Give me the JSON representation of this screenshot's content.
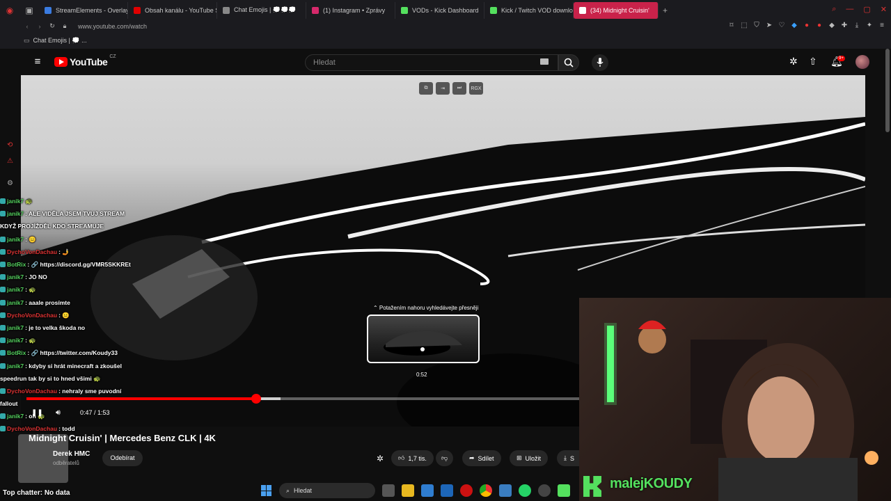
{
  "browser": {
    "tabs": [
      {
        "label": "StreamElements - Overlay",
        "color": "#3a7be0"
      },
      {
        "label": "Obsah kanálu - YouTube S",
        "color": "#e00000"
      },
      {
        "label": "Chat Emojis | 💭💭💭",
        "color": "#888888"
      },
      {
        "label": "(1) Instagram • Zprávy",
        "color": "#d6296b"
      },
      {
        "label": "VODs - Kick Dashboard",
        "color": "#54e05e"
      },
      {
        "label": "Kick / Twitch VOD downlo",
        "color": "#54e05e"
      },
      {
        "label": "(34) Midnight Cruisin'",
        "color": "#ffffff",
        "active": true
      }
    ],
    "url": "www.youtube.com/watch",
    "bookmark": "Chat Emojis | 💭 ..."
  },
  "youtube": {
    "logo_text": "YouTube",
    "region": "CZ",
    "search_placeholder": "Hledat",
    "notification_count": "9+"
  },
  "player": {
    "top_icons": [
      "miniplayer",
      "theater",
      "next",
      "RGX"
    ],
    "seek_hint": "⌃ Potažením nahoru vyhledávejte přesněji",
    "preview_time": "0:52",
    "current_time": "0:47",
    "duration": "1:53",
    "time_display": "0:47 / 1:53",
    "progress_fraction": 0.416,
    "hover_fraction": 0.46
  },
  "chat": [
    {
      "user": "janik7",
      "msg": "🐢",
      "color": "green"
    },
    {
      "user": "janik7",
      "msg": ": ALE VIDĚLA JSEM TVUJ STREAM",
      "color": "green"
    },
    {
      "user": "",
      "msg": "KDYŽ PROJÍŽDĚL KDO STREAMUJE",
      "color": "green"
    },
    {
      "user": "janik7",
      "msg": ": 😐",
      "color": "green"
    },
    {
      "user": "DychoVonDachau",
      "msg": ": 🤳",
      "color": "red"
    },
    {
      "user": "BotRix",
      "msg": ": 🔗 https://discord.gg/VMR5SKKREt",
      "color": "green"
    },
    {
      "user": "janik7",
      "msg": ": JO NO",
      "color": "green"
    },
    {
      "user": "janik7",
      "msg": ": 🐢",
      "color": "green"
    },
    {
      "user": "janik7",
      "msg": ": aaale prosímte",
      "color": "green"
    },
    {
      "user": "DychoVonDachau",
      "msg": ": 😐",
      "color": "red"
    },
    {
      "user": "janik7",
      "msg": ": je to velka škoda no",
      "color": "green"
    },
    {
      "user": "janik7",
      "msg": ": 🐢",
      "color": "green"
    },
    {
      "user": "BotRix",
      "msg": ": 🔗 https://twitter.com/Koudy33",
      "color": "green"
    },
    {
      "user": "janik7",
      "msg": ": kdyby si hrát minecraft a zkoušel",
      "color": "green"
    },
    {
      "user": "",
      "msg": "speedrun tak by si to hned všimi 🐢",
      "color": "green"
    },
    {
      "user": "DychoVonDachau",
      "msg": ": nehraly sme puvodní",
      "color": "red"
    },
    {
      "user": "",
      "msg": "fallout",
      "color": "green"
    },
    {
      "user": "janik7",
      "msg": ": oh 🐢",
      "color": "green"
    },
    {
      "user": "DychoVonDachau",
      "msg": ": todd",
      "color": "red"
    }
  ],
  "video": {
    "title": "Midnight Cruisin' | Mercedes Benz CLK | 4K",
    "channel": "Derek HMC",
    "subscribers": "odběratelů",
    "subscribe_label": "Odebírat",
    "likes": "1,7 tis.",
    "share_label": "Sdílet",
    "save_label": "Uložit",
    "download_label": "S"
  },
  "stream": {
    "streamer": "malejKOUDY",
    "top_chatter": "Top chatter: No data"
  },
  "taskbar": {
    "search_label": "Hledat"
  }
}
